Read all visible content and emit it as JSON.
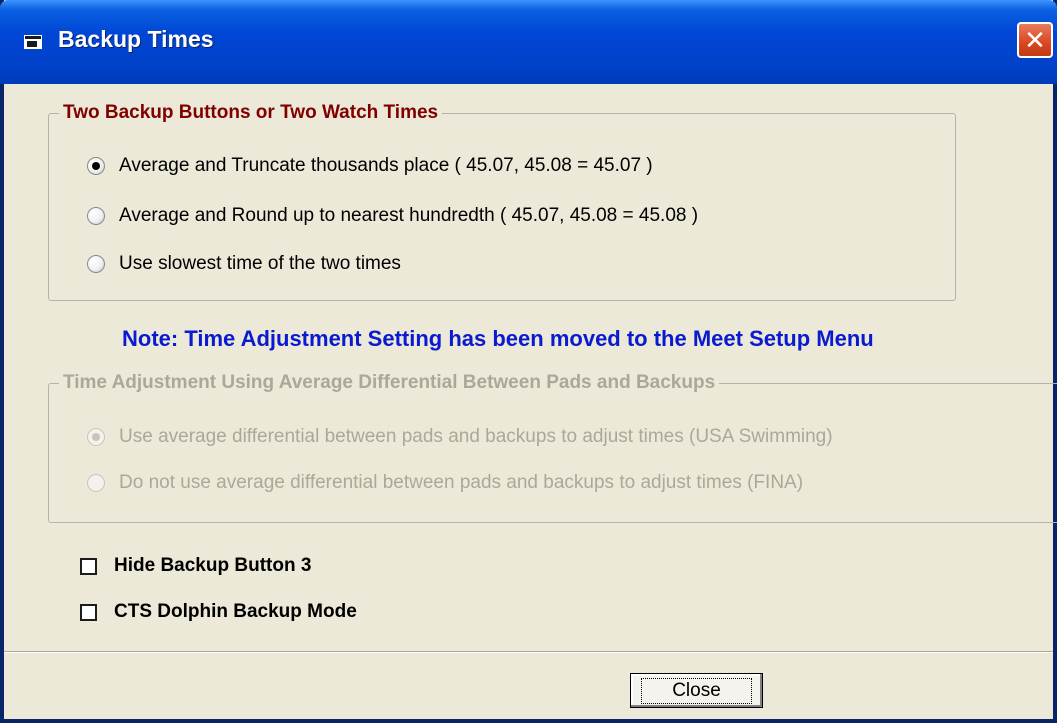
{
  "window": {
    "title": "Backup Times",
    "close_glyph": "✕",
    "title_icon": "window-app-icon"
  },
  "group1": {
    "legend": "Two Backup Buttons or Two Watch Times",
    "legend_color": "#800000",
    "options": [
      {
        "label": "Average and Truncate thousands place  ( 45.07, 45.08 = 45.07 )",
        "checked": true
      },
      {
        "label": "Average and Round up to nearest hundredth  ( 45.07, 45.08 = 45.08 )",
        "checked": false
      },
      {
        "label": "Use slowest time of the two times",
        "checked": false
      }
    ]
  },
  "note": {
    "text": "Note: Time Adjustment Setting has been moved to the Meet Setup Menu",
    "color": "#0a1ad0"
  },
  "group2": {
    "legend": "Time Adjustment Using Average Differential Between Pads and Backups",
    "disabled": true,
    "options": [
      {
        "label": "Use average differential between pads and backups to adjust times (USA Swimming)",
        "checked": true
      },
      {
        "label": "Do not use average differential between pads and backups to adjust times (FINA)",
        "checked": false
      }
    ]
  },
  "checkboxes": [
    {
      "label": "Hide Backup Button 3",
      "checked": false
    },
    {
      "label": "CTS Dolphin Backup Mode",
      "checked": false
    }
  ],
  "footer": {
    "close_label": "Close"
  }
}
